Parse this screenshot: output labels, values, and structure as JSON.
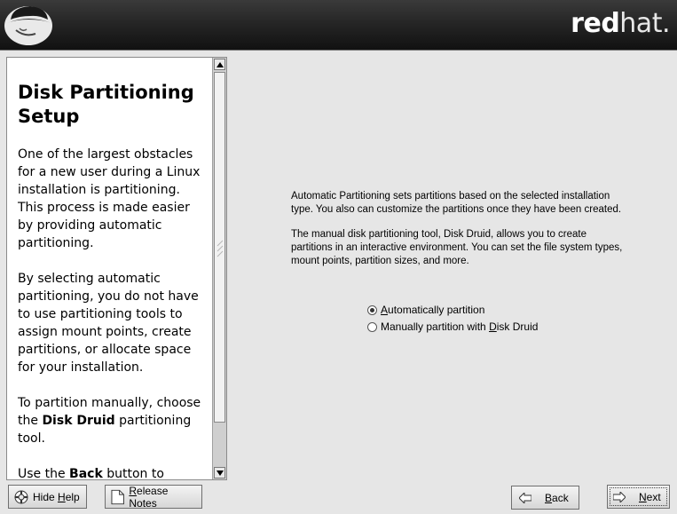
{
  "header": {
    "brand_bold": "red",
    "brand_light": "hat."
  },
  "help": {
    "title": "Disk Partitioning Setup",
    "p1": "One of the largest obstacles for a new user during a Linux installation is partitioning. This process is made easier by providing automatic partitioning.",
    "p2": "By selecting automatic partitioning, you do not have to use partitioning tools to assign mount points, create partitions, or allocate space for your installation.",
    "p3_pre": "To partition manually, choose the ",
    "p3_bold": "Disk Druid",
    "p3_post": " partitioning tool.",
    "p4_pre": "Use the ",
    "p4_bold": "Back",
    "p4_post": " button to choose a different installation."
  },
  "main": {
    "para1": "Automatic Partitioning sets partitions based on the selected installation type. You also can customize the partitions once they have been created.",
    "para2": "The manual disk partitioning tool, Disk Druid, allows you to create partitions in an interactive environment. You can set the file system types, mount points, partition sizes, and more.",
    "option_auto": {
      "mnemonic": "A",
      "rest": "utomatically partition",
      "selected": true
    },
    "option_manual": {
      "pre": "Manually partition with ",
      "mnemonic": "D",
      "rest": "isk Druid",
      "selected": false
    }
  },
  "buttons": {
    "hide_help_pre": "Hide ",
    "hide_help_mnemonic": "H",
    "hide_help_rest": "elp",
    "release_mnemonic": "R",
    "release_rest": "elease Notes",
    "back_mnemonic": "B",
    "back_rest": "ack",
    "next_mnemonic": "N",
    "next_rest": "ext"
  },
  "icons": {
    "logo": "shadowman-hat-icon",
    "hide_help": "lifebuoy-icon",
    "release_notes": "document-icon",
    "back": "left-arrow-icon",
    "next": "right-arrow-icon"
  }
}
